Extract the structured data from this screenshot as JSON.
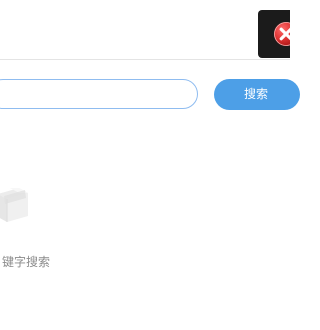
{
  "search": {
    "placeholder": "",
    "value": "",
    "button_label": "搜索"
  },
  "empty_state": {
    "message": "键字搜索"
  },
  "colors": {
    "primary": "#4d9fe7",
    "input_border": "#8fbcf0",
    "close_badge": "#d72d2d",
    "dark_panel": "#1b1b1b",
    "muted_text": "#8b8b8b"
  },
  "icons": {
    "close": "close-icon",
    "empty": "package-icon"
  }
}
